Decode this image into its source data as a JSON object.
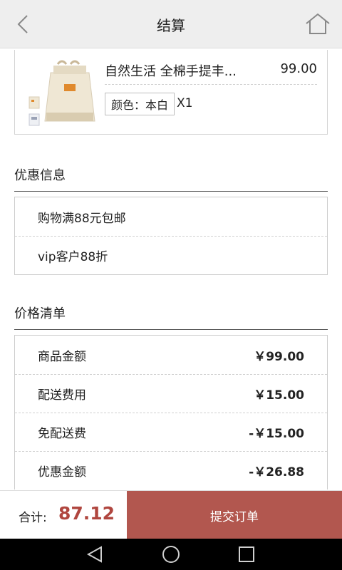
{
  "header": {
    "title": "结算",
    "back_icon": "chevron-left-icon",
    "home_icon": "home-icon"
  },
  "product": {
    "name": "自然生活  全棉手提丰...",
    "price": "99.00",
    "color_label": "颜色：本白",
    "quantity": "X1",
    "image": "tote-bag-thumbnail"
  },
  "discounts": {
    "title": "优惠信息",
    "items": [
      {
        "label": "购物满88元包邮"
      },
      {
        "label": "vip客户88折"
      }
    ]
  },
  "prices": {
    "title": "价格清单",
    "rows": [
      {
        "label": "商品金额",
        "value": "￥99.00"
      },
      {
        "label": "配送费用",
        "value": "￥15.00"
      },
      {
        "label": "免配送费",
        "value": "-￥15.00"
      },
      {
        "label": "优惠金额",
        "value": "-￥26.88"
      }
    ]
  },
  "footer": {
    "total_label": "合计:",
    "total_value": "87.12",
    "submit_label": "提交订单"
  },
  "colors": {
    "accent": "#b2574f",
    "total_text": "#b0463f",
    "header_bg": "#eeeeee"
  }
}
